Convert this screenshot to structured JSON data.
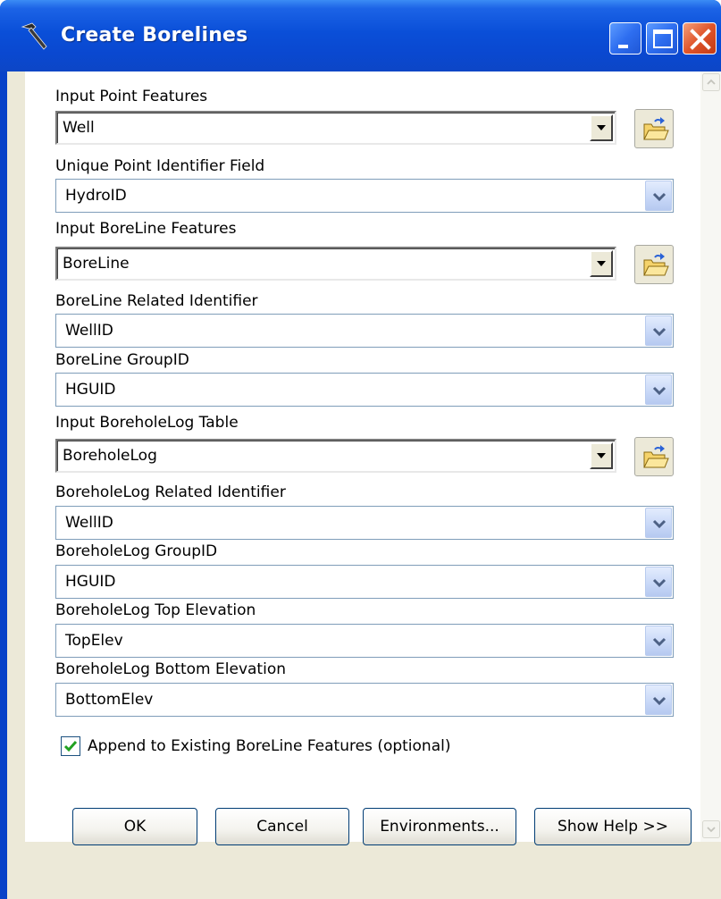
{
  "window": {
    "title": "Create Borelines",
    "title_icon": "hammer-icon",
    "colors": {
      "titlebar": "#0a4fd8",
      "client": "#ece9d8",
      "close": "#e0552a"
    }
  },
  "fields": [
    {
      "id": "input-point-features",
      "label": "Input Point Features",
      "value": "Well",
      "style": "combo-browse"
    },
    {
      "id": "unique-point-identifier-field",
      "label": "Unique Point Identifier Field",
      "value": "HydroID",
      "style": "dropdown"
    },
    {
      "id": "input-boreline-features",
      "label": "Input BoreLine Features",
      "value": "BoreLine",
      "style": "combo-browse"
    },
    {
      "id": "boreline-related-identifier",
      "label": "BoreLine Related Identifier",
      "value": "WellID",
      "style": "dropdown"
    },
    {
      "id": "boreline-groupid",
      "label": "BoreLine GroupID",
      "value": "HGUID",
      "style": "dropdown"
    },
    {
      "id": "input-boreholelog-table",
      "label": "Input BoreholeLog Table",
      "value": "BoreholeLog",
      "style": "combo-browse"
    },
    {
      "id": "boreholelog-related-identifier",
      "label": "BoreholeLog Related Identifier",
      "value": "WellID",
      "style": "dropdown"
    },
    {
      "id": "boreholelog-groupid",
      "label": "BoreholeLog GroupID",
      "value": "HGUID",
      "style": "dropdown"
    },
    {
      "id": "boreholelog-top-elevation",
      "label": "BoreholeLog Top Elevation",
      "value": "TopElev",
      "style": "dropdown"
    },
    {
      "id": "boreholelog-bottom-elevation",
      "label": "BoreholeLog Bottom Elevation",
      "value": "BottomElev",
      "style": "dropdown"
    }
  ],
  "append_option": {
    "label": "Append to Existing BoreLine Features (optional)",
    "checked": true
  },
  "buttons": {
    "ok": "OK",
    "cancel": "Cancel",
    "environments": "Environments...",
    "show_help": "Show Help >>"
  }
}
